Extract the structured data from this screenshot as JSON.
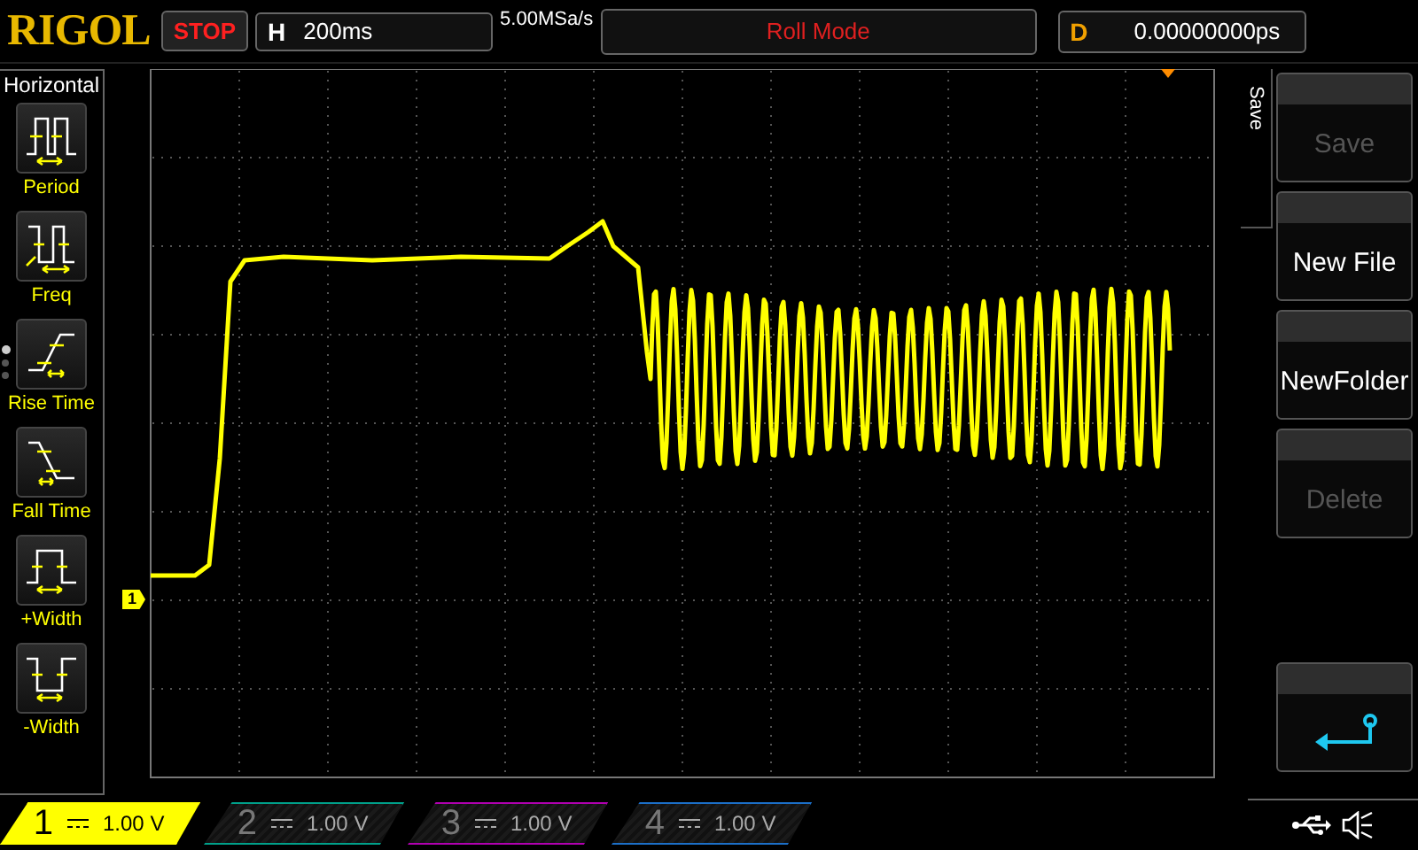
{
  "header": {
    "brand": "RIGOL",
    "run_state": "STOP",
    "timebase_label": "H",
    "timebase": "200ms",
    "sample_rate": "5.00MSa/s",
    "mode": "Roll Mode",
    "delay_label": "D",
    "delay": "0.00000000ps"
  },
  "measure_panel": {
    "title": "Horizontal",
    "items": [
      {
        "label": "Period",
        "kind": "period"
      },
      {
        "label": "Freq",
        "kind": "freq"
      },
      {
        "label": "Rise Time",
        "kind": "rise"
      },
      {
        "label": "Fall Time",
        "kind": "fall"
      },
      {
        "label": "+Width",
        "kind": "pwidth"
      },
      {
        "label": "-Width",
        "kind": "nwidth"
      }
    ],
    "pages": [
      {
        "selected": true
      },
      {
        "selected": false
      },
      {
        "selected": false
      }
    ]
  },
  "channel_marker": "1",
  "menu": {
    "title": "Save",
    "buttons": [
      {
        "kind": "text",
        "label": "Save",
        "disabled": true
      },
      {
        "kind": "text",
        "label": "New File",
        "disabled": false
      },
      {
        "kind": "text",
        "label": "NewFolder",
        "disabled": false
      },
      {
        "kind": "text",
        "label": "Delete",
        "disabled": true
      },
      {
        "kind": "back"
      }
    ]
  },
  "channels": [
    {
      "number": "1",
      "scale": "1.00 V",
      "on": true,
      "color": "#ffff00"
    },
    {
      "number": "2",
      "scale": "1.00 V",
      "on": false,
      "color": "#00a08a"
    },
    {
      "number": "3",
      "scale": "1.00 V",
      "on": false,
      "color": "#b000b0"
    },
    {
      "number": "4",
      "scale": "1.00 V",
      "on": false,
      "color": "#1c6fc8"
    }
  ]
}
